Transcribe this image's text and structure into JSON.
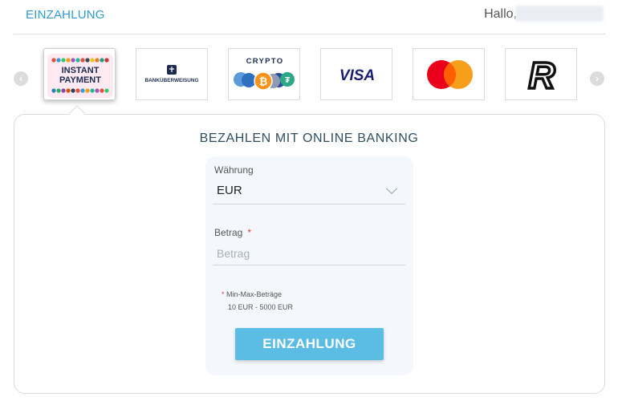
{
  "header": {
    "title": "EINZAHLUNG",
    "greeting": "Hallo,"
  },
  "carousel": {
    "prev_icon": "chevron-left-icon",
    "next_icon": "chevron-right-icon"
  },
  "methods": [
    {
      "name": "instant-payment",
      "line1": "INSTANT",
      "line2": "PAYMENT",
      "selected": true
    },
    {
      "name": "bankueberweisung",
      "label": "BANKÜBERWEISUNG"
    },
    {
      "name": "crypto",
      "label": "CRYPTO"
    },
    {
      "name": "visa",
      "label": "VISA"
    },
    {
      "name": "mastercard",
      "label": ""
    },
    {
      "name": "revolut",
      "label": "R"
    }
  ],
  "panel": {
    "title": "BEZAHLEN MIT ONLINE BANKING"
  },
  "form": {
    "currency_label": "Währung",
    "currency_value": "EUR",
    "amount_label": "Betrag",
    "amount_required": "*",
    "amount_placeholder": "Betrag",
    "minmax_star": "*",
    "minmax_label": "Min-Max-Beträge",
    "minmax_value": "10 EUR - 5000 EUR",
    "submit_label": "EINZAHLUNG"
  },
  "colors": {
    "accent": "#2f9cc9",
    "button": "#5bbde4",
    "required": "#e03b3b",
    "visa": "#1a1f71",
    "mastercard_red": "#eb001b",
    "mastercard_orange": "#f79e1b",
    "bitcoin": "#f7931a"
  }
}
